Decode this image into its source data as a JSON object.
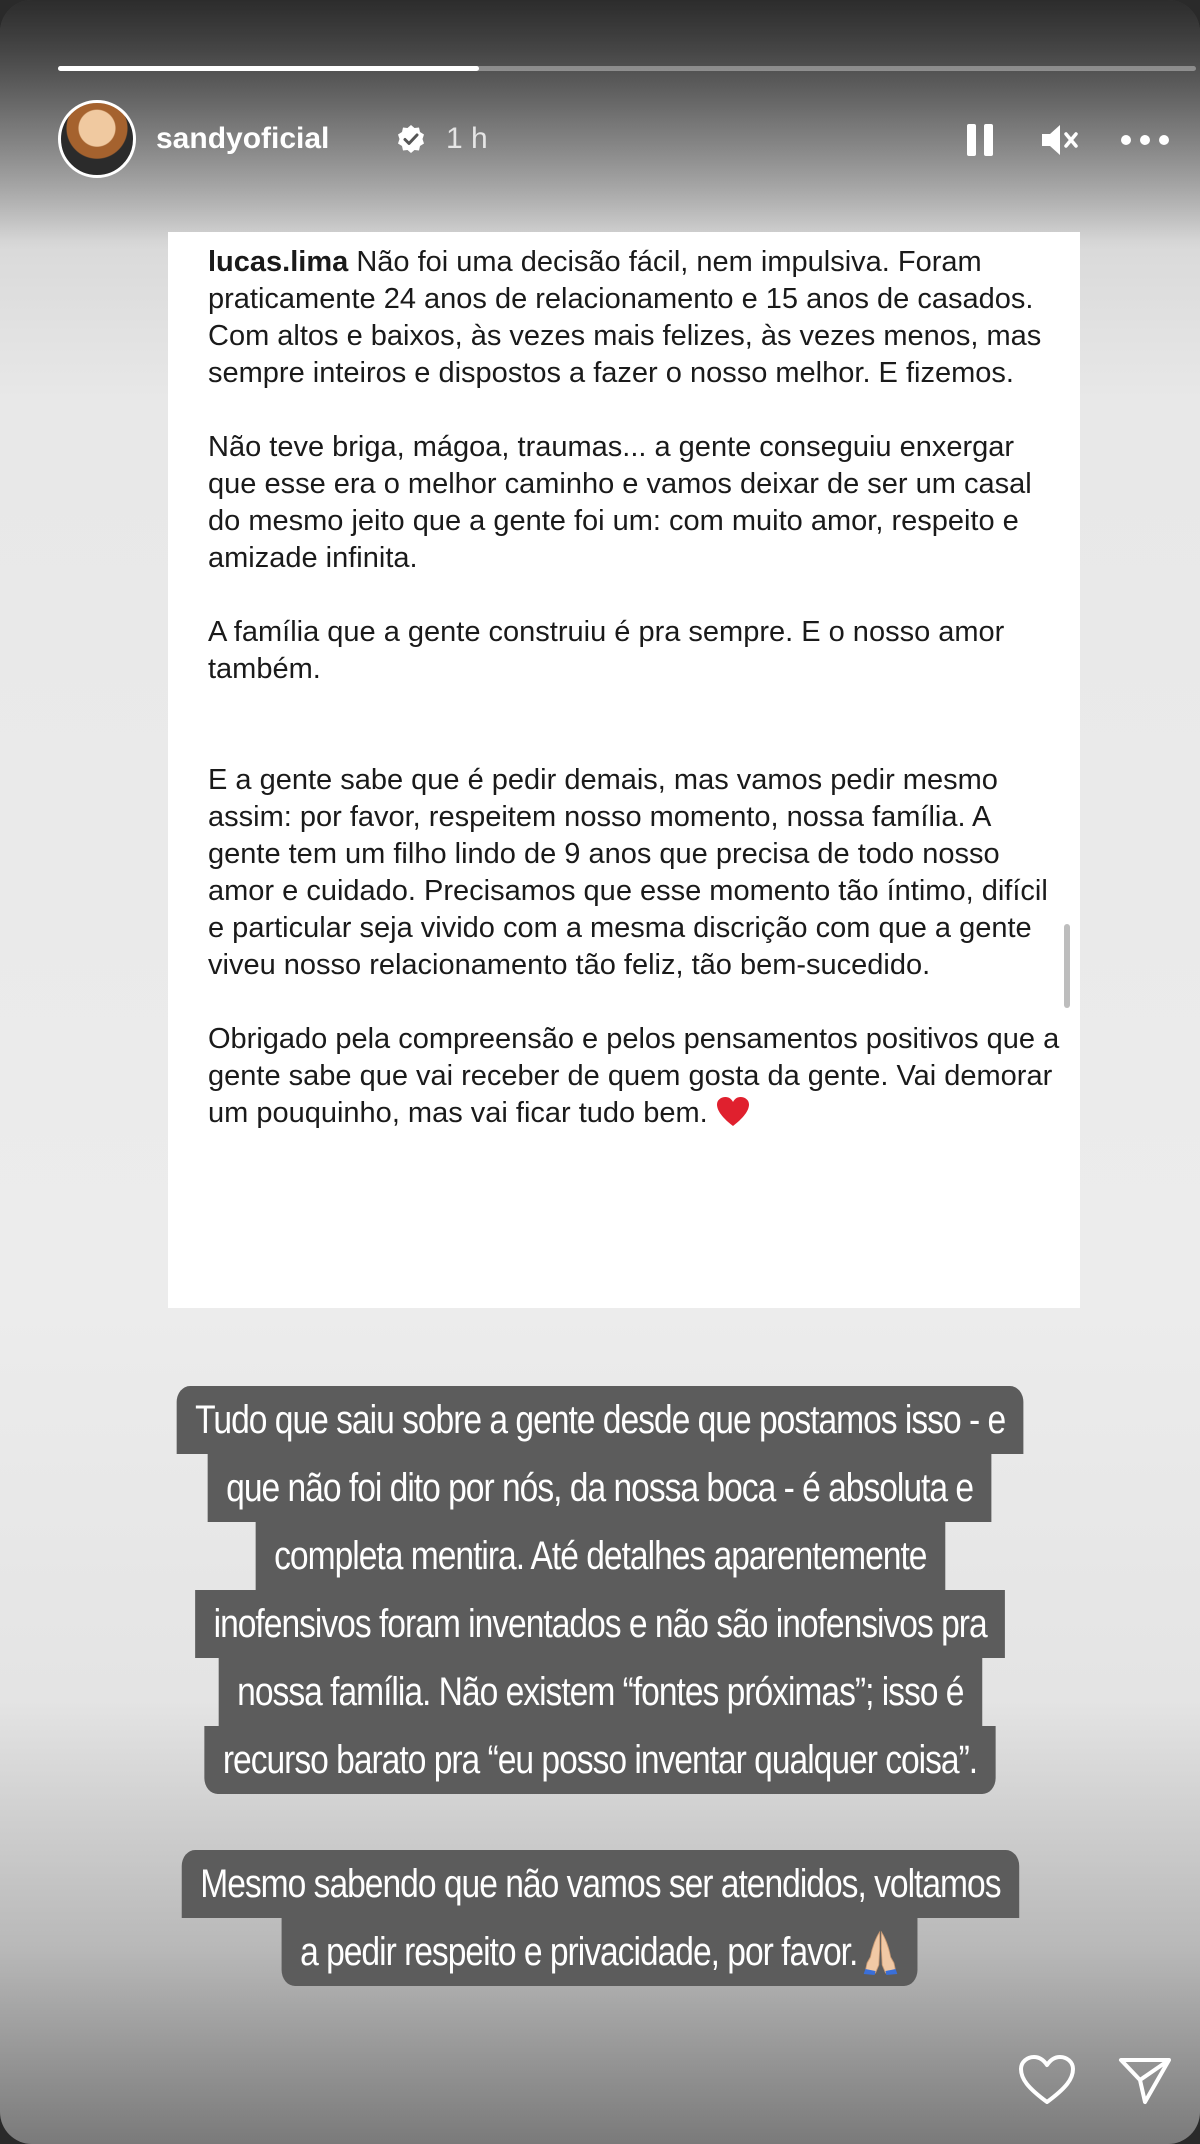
{
  "story": {
    "progress_fraction": 0.37,
    "user": {
      "username": "sandyoficial",
      "verified_icon": "verified-badge-icon",
      "time_ago": "1 h"
    },
    "controls": {
      "pause_icon": "pause-icon",
      "mute_icon": "speaker-muted-icon",
      "more_icon": "more-options-icon"
    }
  },
  "post": {
    "username": "lucas.lima",
    "paragraph1": "Não foi uma decisão fácil, nem impulsiva. Foram praticamente 24 anos de relacionamento e 15 anos de casados. Com altos e baixos, às vezes mais felizes, às vezes menos, mas sempre inteiros e dispostos a fazer o nosso melhor. E fizemos.",
    "paragraph2": "Não teve briga, mágoa, traumas... a gente conseguiu enxergar que esse era o melhor caminho e vamos deixar de ser um casal do mesmo jeito que a gente foi um: com muito amor, respeito e amizade infinita.",
    "paragraph3": "A família que a gente construiu é pra sempre. E o nosso amor também.",
    "paragraph4": "E a gente sabe que é pedir demais, mas vamos pedir mesmo assim: por favor, respeitem nosso momento, nossa família. A gente tem um filho lindo de 9 anos que precisa de todo nosso amor e cuidado. Precisamos que esse momento tão íntimo, difícil e particular seja vivido com a mesma discrição com que a gente viveu nosso relacionamento tão feliz, tão bem-sucedido.",
    "paragraph5": "Obrigado pela compreensão e pelos pensamentos positivos que a gente sabe que vai receber de quem gosta da gente. Vai demorar um pouquinho, mas vai ficar tudo bem.",
    "emoji": "red-heart-emoji"
  },
  "overlay1": {
    "lines": [
      "Tudo que saiu sobre a gente desde que postamos isso - e",
      "que não foi dito por nós, da nossa boca -  é absoluta e",
      "completa mentira. Até detalhes aparentemente",
      "inofensivos foram inventados e não são inofensivos pra",
      "nossa família. Não existem “fontes próximas”; isso é",
      "recurso barato pra “eu posso inventar qualquer coisa”."
    ]
  },
  "overlay2": {
    "lines": [
      "Mesmo sabendo que não vamos ser atendidos, voltamos",
      "a pedir respeito e privacidade, por favor."
    ],
    "emoji": "folded-hands-emoji"
  },
  "footer": {
    "like_icon": "heart-outline-icon",
    "share_icon": "send-icon"
  },
  "colors": {
    "overlay_bg": "#5c5c5c",
    "card_bg": "#ffffff",
    "heart_red": "#e0202e"
  }
}
